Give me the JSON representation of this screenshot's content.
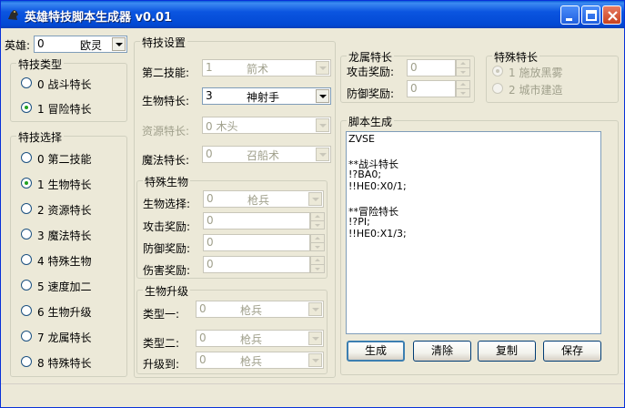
{
  "window": {
    "title": "英雄特技脚本生成器 v0.01"
  },
  "hero": {
    "label": "英雄:",
    "value_num": "0",
    "value_name": "欧灵"
  },
  "specialty_type": {
    "title": "特技类型",
    "options": [
      "0 战斗特长",
      "1 冒险特长"
    ],
    "selected": 1
  },
  "specialty_select": {
    "title": "特技选择",
    "options": [
      "0 第二技能",
      "1 生物特长",
      "2 资源特长",
      "3 魔法特长",
      "4 特殊生物",
      "5 速度加二",
      "6 生物升级",
      "7 龙属特长",
      "8 特殊特长"
    ],
    "selected": 1
  },
  "specialty_settings": {
    "title": "特技设置",
    "rows": [
      {
        "label": "第二技能:",
        "num": "1",
        "name": "箭术",
        "enabled": false
      },
      {
        "label": "生物特长:",
        "num": "3",
        "name": "神射手",
        "enabled": true
      },
      {
        "label": "资源特长:",
        "num": "0 木头",
        "name": "",
        "enabled": false
      },
      {
        "label": "魔法特长:",
        "num": "0",
        "name": "召船术",
        "enabled": false
      }
    ]
  },
  "special_creature": {
    "title": "特殊生物",
    "creature_label": "生物选择:",
    "creature_num": "0",
    "creature_name": "枪兵",
    "attack_label": "攻击奖励:",
    "attack_value": "0",
    "defense_label": "防御奖励:",
    "defense_value": "0",
    "damage_label": "伤害奖励:",
    "damage_value": "0"
  },
  "creature_upgrade": {
    "title": "生物升级",
    "type1_label": "类型一:",
    "type1_num": "0",
    "type1_name": "枪兵",
    "type2_label": "类型二:",
    "type2_num": "0",
    "type2_name": "枪兵",
    "upgrade_label": "升级到:",
    "upgrade_num": "0",
    "upgrade_name": "枪兵"
  },
  "dragon": {
    "title": "龙属特长",
    "attack_label": "攻击奖励:",
    "attack_value": "0",
    "defense_label": "防御奖励:",
    "defense_value": "0"
  },
  "special_specialty": {
    "title": "特殊特长",
    "options": [
      "1 施放黑雾",
      "2 城市建造"
    ],
    "selected": 0
  },
  "script_gen": {
    "title": "脚本生成",
    "lines": [
      "ZVSE",
      "",
      "**战斗特长",
      "!?BA0;",
      "!!HE0:X0/1;",
      "",
      "**冒险特长",
      "!?PI;",
      "!!HE0:X1/3;"
    ]
  },
  "buttons": {
    "generate": "生成",
    "clear": "清除",
    "copy": "复制",
    "save": "保存"
  }
}
